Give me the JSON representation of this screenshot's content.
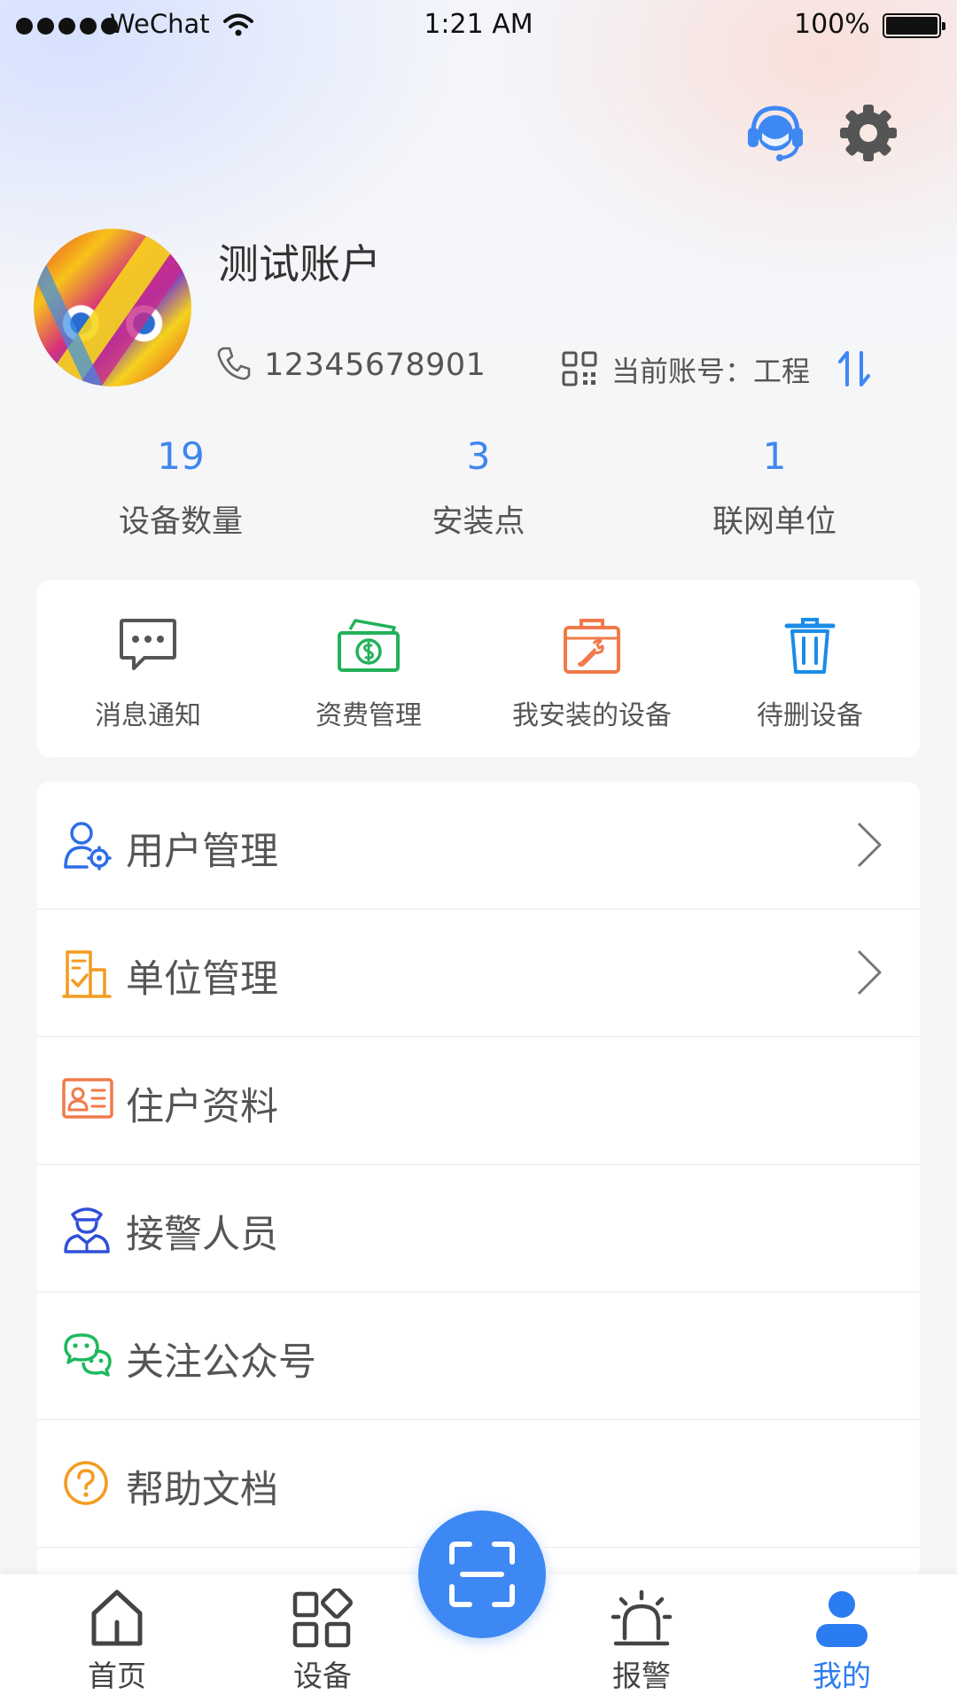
{
  "status_bar": {
    "carrier": "WeChat",
    "time": "1:21 AM",
    "battery": "100%"
  },
  "header": {
    "support_icon": "customer-service-icon",
    "settings_icon": "gear-icon"
  },
  "profile": {
    "name": "测试账户",
    "phone": "12345678901",
    "account_text": "当前账号：工程"
  },
  "stats": [
    {
      "value": "19",
      "label": "设备数量"
    },
    {
      "value": "3",
      "label": "安装点"
    },
    {
      "value": "1",
      "label": "联网单位"
    }
  ],
  "quick_actions": [
    {
      "label": "消息通知",
      "icon": "message-icon",
      "color": "#555555"
    },
    {
      "label": "资费管理",
      "icon": "money-icon",
      "color": "#22b25a"
    },
    {
      "label": "我安装的设备",
      "icon": "toolbox-icon",
      "color": "#f07a4a"
    },
    {
      "label": "待删设备",
      "icon": "trash-icon",
      "color": "#1a8ce8"
    }
  ],
  "menu": [
    {
      "label": "用户管理",
      "icon": "user-settings-icon",
      "has_arrow": true
    },
    {
      "label": "单位管理",
      "icon": "building-icon",
      "has_arrow": true
    },
    {
      "label": "住户资料",
      "icon": "id-card-icon",
      "has_arrow": false
    },
    {
      "label": "接警人员",
      "icon": "officer-icon",
      "has_arrow": false
    },
    {
      "label": "关注公众号",
      "icon": "wechat-icon",
      "has_arrow": false
    },
    {
      "label": "帮助文档",
      "icon": "help-icon",
      "has_arrow": false
    }
  ],
  "tabs": [
    {
      "label": "首页",
      "icon": "home-icon",
      "active": false
    },
    {
      "label": "设备",
      "icon": "grid-icon",
      "active": false
    },
    {
      "label": "报警",
      "icon": "alarm-icon",
      "active": false
    },
    {
      "label": "我的",
      "icon": "user-icon",
      "active": true
    }
  ],
  "colors": {
    "accent": "#3d88f3",
    "stat_number": "#3f86ee",
    "active_tab": "#2a7cf0"
  }
}
